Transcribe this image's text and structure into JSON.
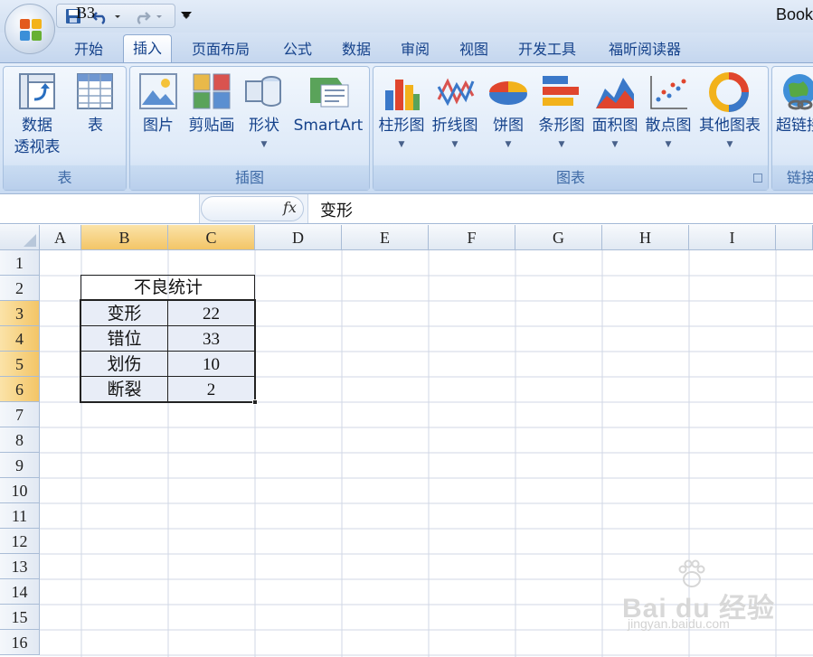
{
  "window": {
    "title": "Book"
  },
  "tabs": [
    "开始",
    "插入",
    "页面布局",
    "公式",
    "数据",
    "审阅",
    "视图",
    "开发工具",
    "福昕阅读器"
  ],
  "active_tab": "插入",
  "ribbon": {
    "groups": {
      "tables": {
        "label": "表",
        "buttons": {
          "pivot_line1": "数据",
          "pivot_line2": "透视表",
          "table": "表"
        }
      },
      "illustrations": {
        "label": "插图",
        "buttons": {
          "picture": "图片",
          "clipart": "剪贴画",
          "shapes": "形状",
          "smartart": "SmartArt"
        }
      },
      "charts": {
        "label": "图表",
        "buttons": {
          "column": "柱形图",
          "line": "折线图",
          "pie": "饼图",
          "bar": "条形图",
          "area": "面积图",
          "scatter": "散点图",
          "other": "其他图表"
        }
      },
      "links": {
        "label": "链接",
        "buttons": {
          "hyperlink": "超链接"
        }
      }
    }
  },
  "formula_bar": {
    "name_box": "B3",
    "fx_label": "fx",
    "content": "变形"
  },
  "grid": {
    "columns": [
      "A",
      "B",
      "C",
      "D",
      "E",
      "F",
      "G",
      "H",
      "I"
    ],
    "rows": [
      "1",
      "2",
      "3",
      "4",
      "5",
      "6",
      "7",
      "8",
      "9",
      "10",
      "11",
      "12",
      "13",
      "14",
      "15",
      "16"
    ],
    "title_cell": "不良统计",
    "table": [
      {
        "label": "变形",
        "value": "22"
      },
      {
        "label": "错位",
        "value": "33"
      },
      {
        "label": "划伤",
        "value": "10"
      },
      {
        "label": "断裂",
        "value": "2"
      }
    ]
  },
  "watermark": {
    "main": "Bai du 经验",
    "sub": "jingyan.baidu.com"
  }
}
